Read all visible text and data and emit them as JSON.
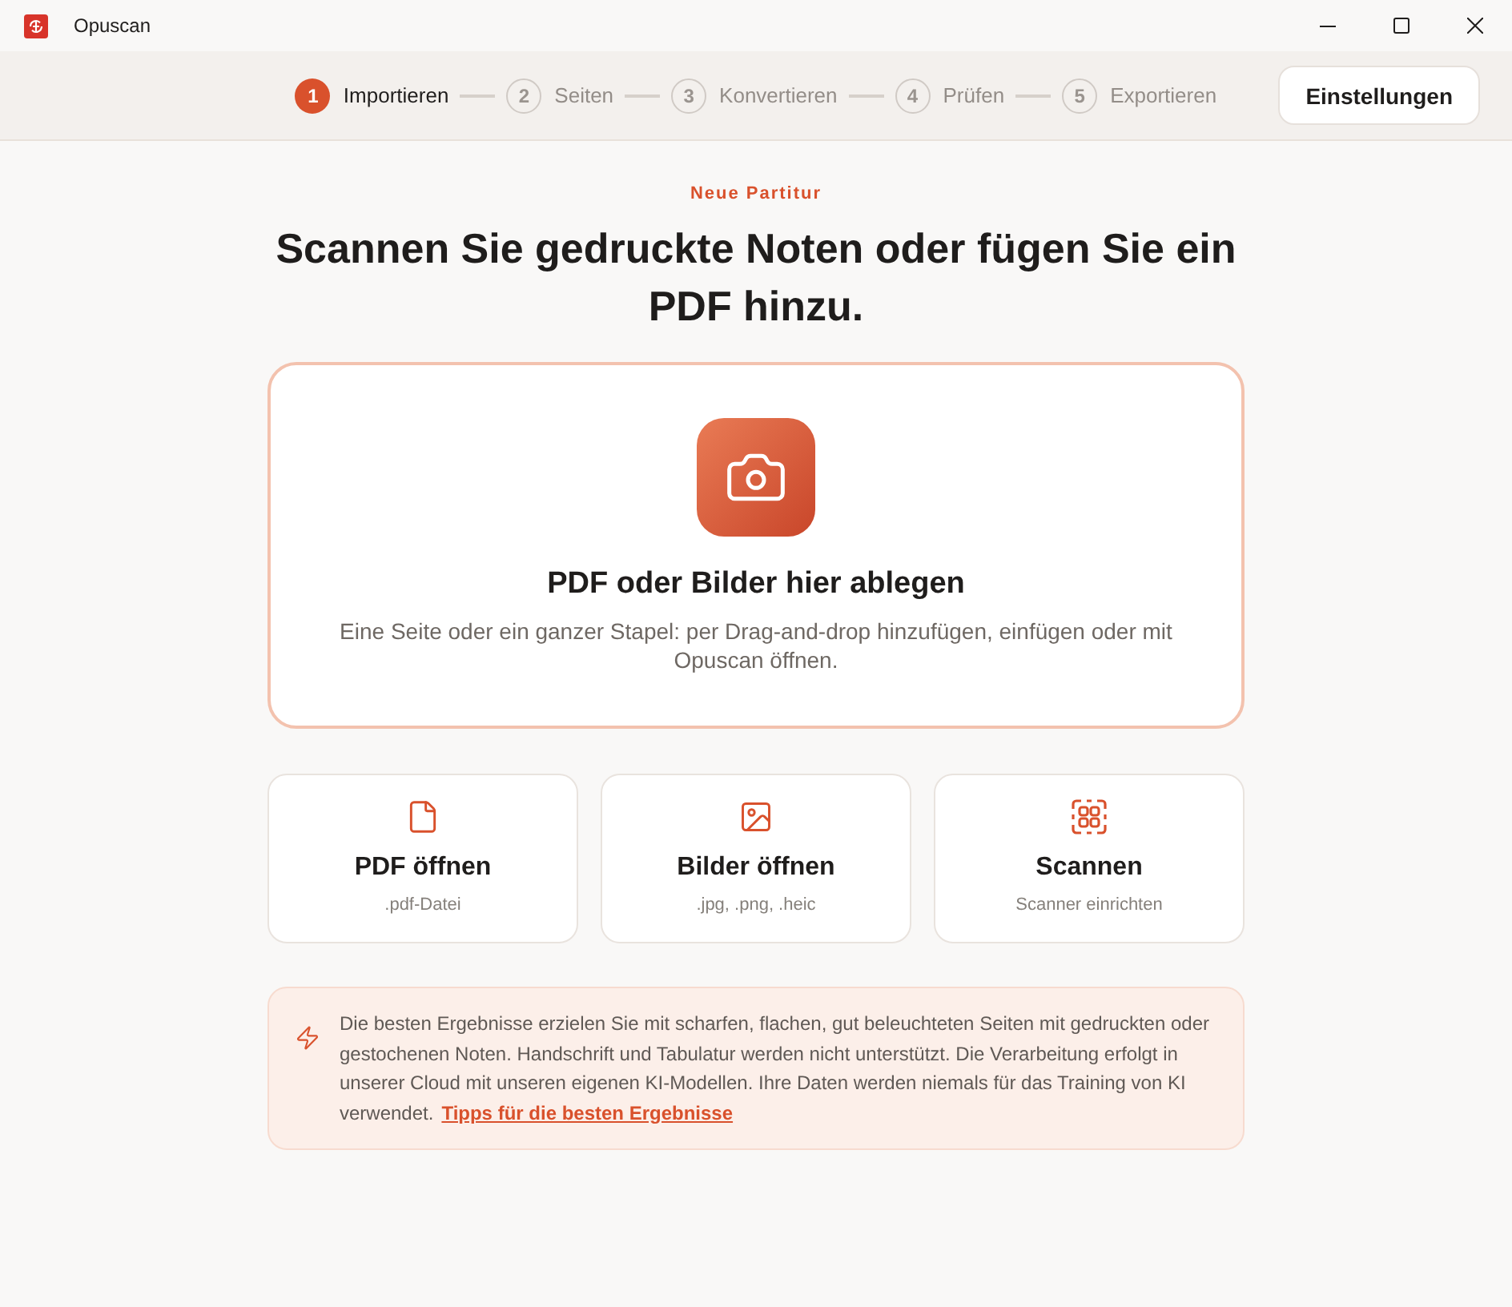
{
  "window": {
    "title": "Opuscan"
  },
  "stepper": {
    "steps": [
      {
        "number": "1",
        "label": "Importieren",
        "selected": true
      },
      {
        "number": "2",
        "label": "Seiten",
        "selected": false
      },
      {
        "number": "3",
        "label": "Konvertieren",
        "selected": false
      },
      {
        "number": "4",
        "label": "Prüfen",
        "selected": false
      },
      {
        "number": "5",
        "label": "Exportieren",
        "selected": false
      }
    ]
  },
  "settings_button": "Einstellungen",
  "eyebrow": "Neue Partitur",
  "heading": "Scannen Sie gedruckte Noten oder fügen Sie ein PDF hinzu.",
  "drop_zone": {
    "title": "PDF oder Bilder hier ablegen",
    "description": "Eine Seite oder ein ganzer Stapel: per Drag-and-drop hinzufügen, einfügen oder mit Opuscan öffnen."
  },
  "options": [
    {
      "kind": "file",
      "title": "PDF öffnen",
      "subtitle": ".pdf-Datei"
    },
    {
      "kind": "image",
      "title": "Bilder öffnen",
      "subtitle": ".jpg, .png, .heic"
    },
    {
      "kind": "scan",
      "title": "Scannen",
      "subtitle": "Scanner einrichten"
    }
  ],
  "info": {
    "text": "Die besten Ergebnisse erzielen Sie mit scharfen, flachen, gut beleuchteten Seiten mit gedruckten oder gestochenen Noten. Handschrift und Tabulatur werden nicht unterstützt. Die Verarbeitung erfolgt in unserer Cloud mit unseren eigenen KI-Modellen. Ihre Daten werden niemals für das Training von KI verwendet.",
    "link": "Tipps für die besten Ergebnisse"
  }
}
